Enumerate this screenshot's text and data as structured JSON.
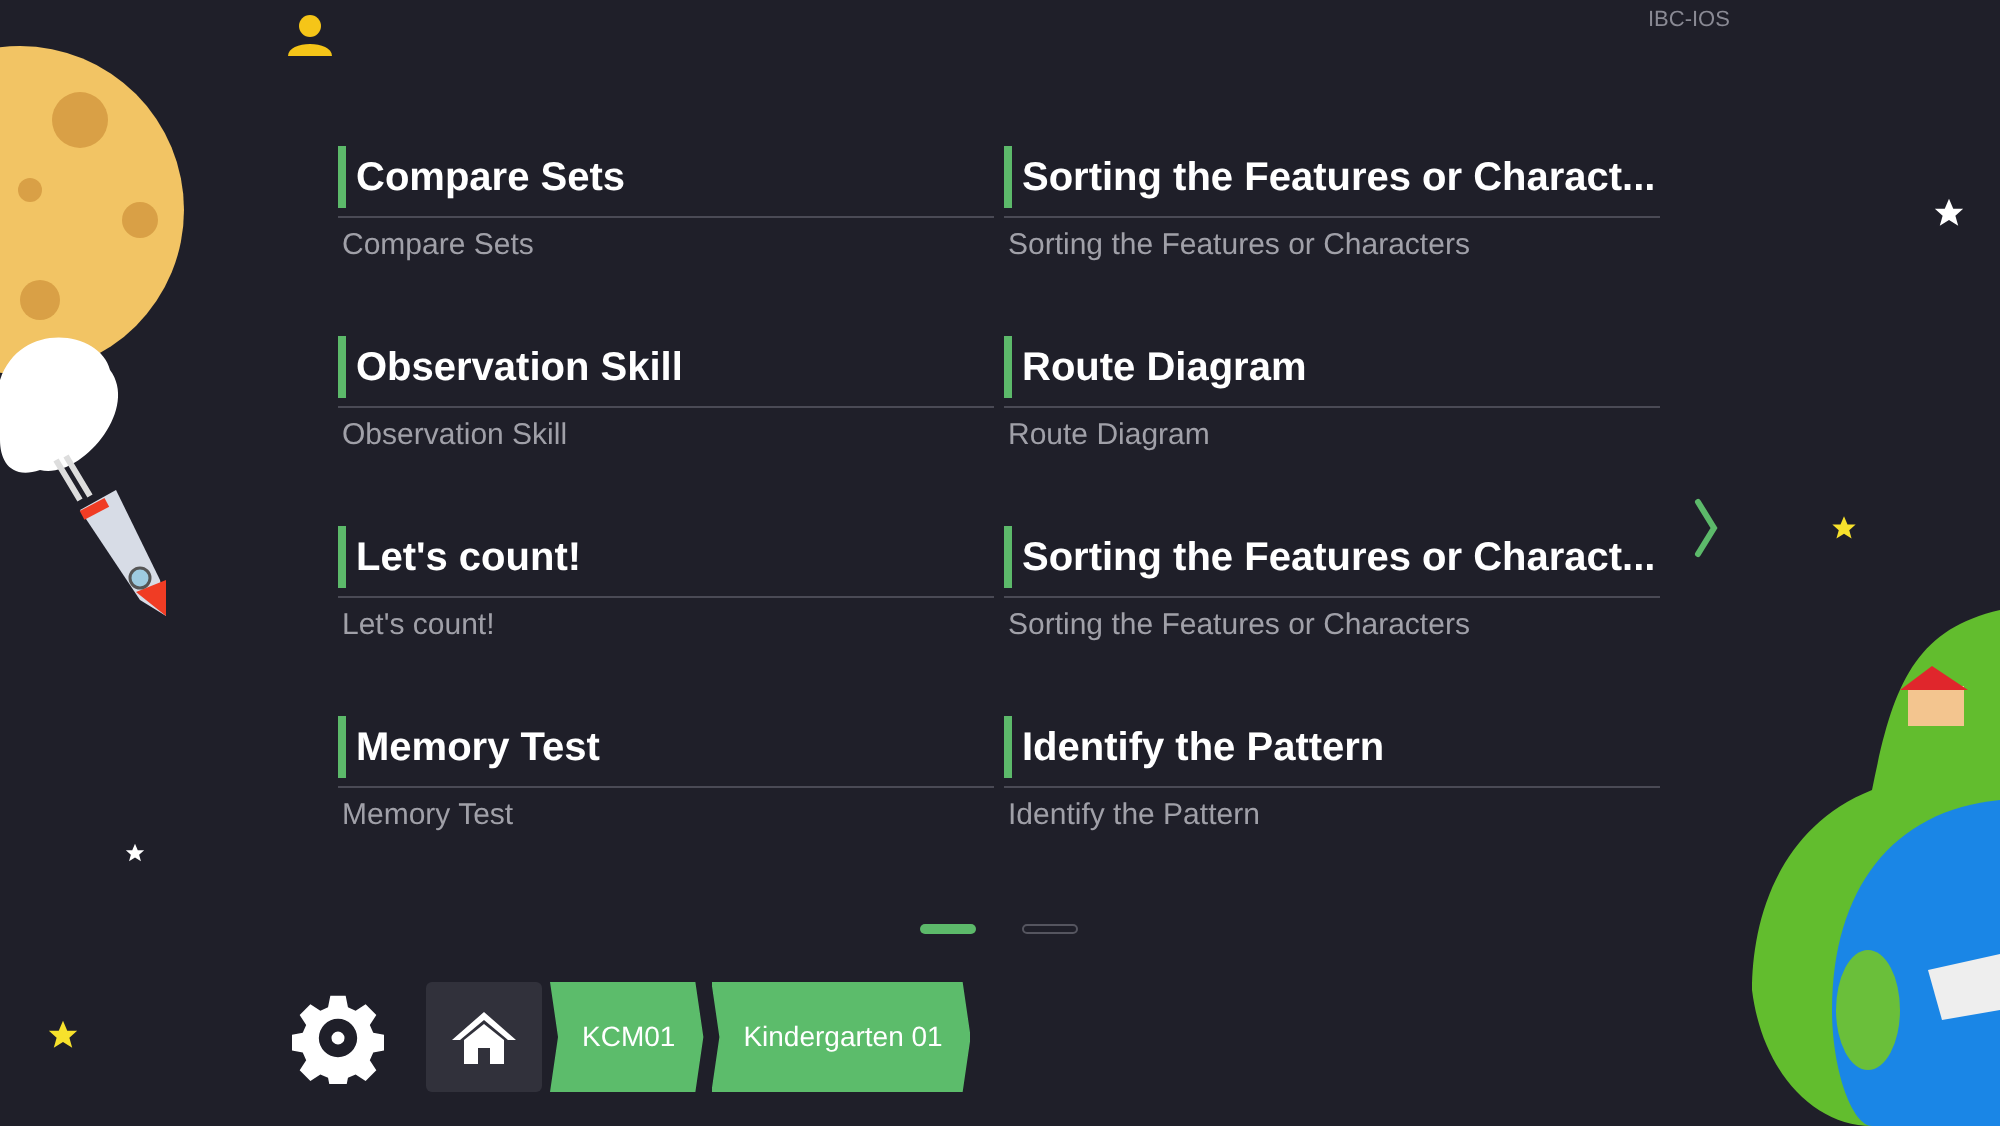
{
  "app_label": "IBC-IOS",
  "lessons": [
    {
      "title": "Compare Sets",
      "subtitle": "Compare Sets"
    },
    {
      "title": "Sorting the Features or Charact...",
      "subtitle": "Sorting the Features or Characters"
    },
    {
      "title": "Observation Skill",
      "subtitle": "Observation Skill"
    },
    {
      "title": "Route Diagram",
      "subtitle": "Route Diagram"
    },
    {
      "title": "Let's count!",
      "subtitle": "Let's count!"
    },
    {
      "title": "Sorting the Features or Charact...",
      "subtitle": "Sorting the Features or Characters"
    },
    {
      "title": "Memory Test",
      "subtitle": "Memory Test"
    },
    {
      "title": "Identify the Pattern",
      "subtitle": "Identify the Pattern"
    }
  ],
  "pages": [
    {
      "selected": true
    },
    {
      "selected": false
    }
  ],
  "breadcrumbs": [
    "KCM01",
    "Kindergarten 01"
  ]
}
